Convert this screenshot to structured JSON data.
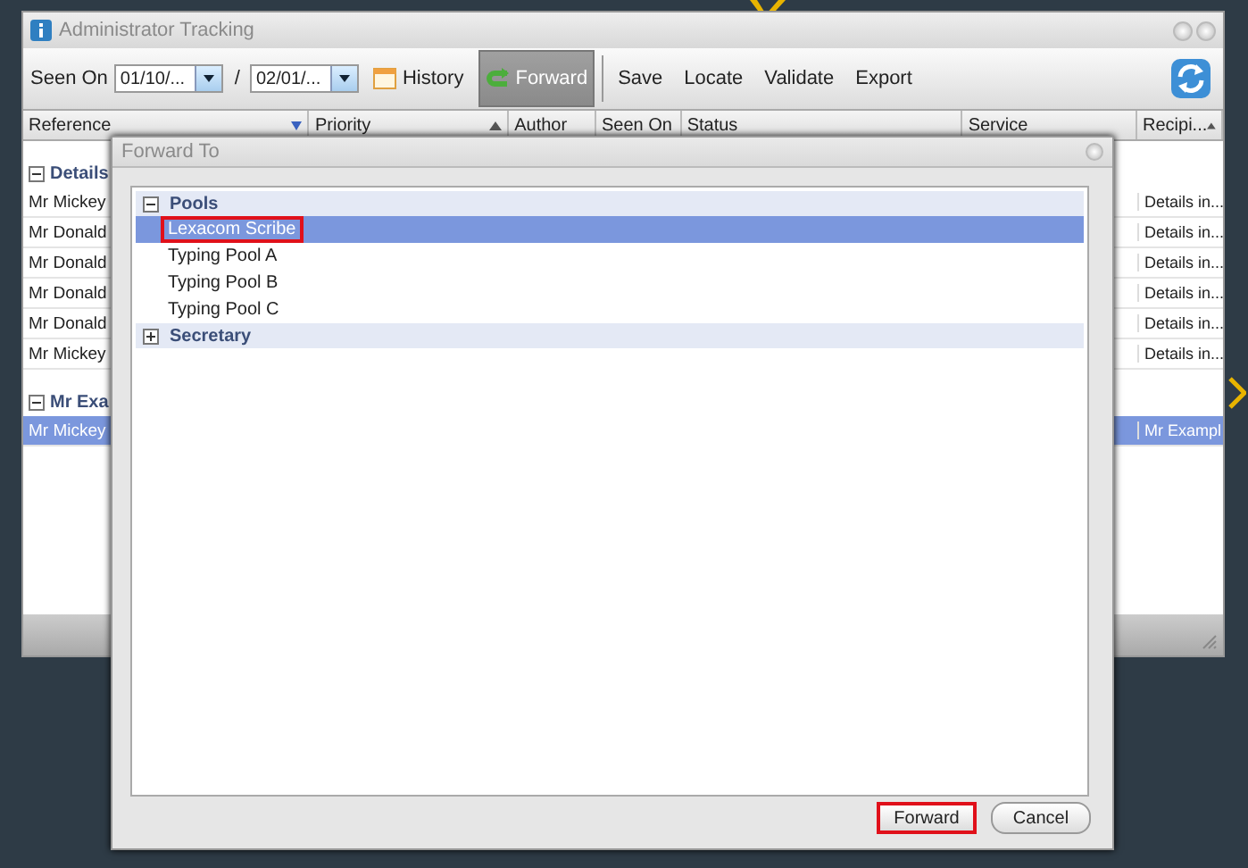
{
  "window": {
    "title": "Administrator Tracking"
  },
  "toolbar": {
    "seen_on_label": "Seen On",
    "date_from": "01/10/...",
    "separator": "/",
    "date_to": "02/01/...",
    "buttons": [
      {
        "label": "History",
        "kind": "calendar",
        "selected": false
      },
      {
        "label": "Forward",
        "kind": "forward",
        "selected": true
      },
      {
        "label": "Save",
        "kind": "plain",
        "selected": false
      },
      {
        "label": "Locate",
        "kind": "plain",
        "selected": false
      },
      {
        "label": "Validate",
        "kind": "plain",
        "selected": false
      },
      {
        "label": "Export",
        "kind": "plain",
        "selected": false
      }
    ]
  },
  "table": {
    "columns": [
      {
        "label": "Reference",
        "filtered": true,
        "sorted": false
      },
      {
        "label": "Priority",
        "filtered": false,
        "sorted": true
      },
      {
        "label": "Author",
        "filtered": false,
        "sorted": false
      },
      {
        "label": "Seen On",
        "filtered": false,
        "sorted": false
      },
      {
        "label": "Status",
        "filtered": false,
        "sorted": false
      },
      {
        "label": "Service",
        "filtered": false,
        "sorted": false
      },
      {
        "label": "Recipi...",
        "filtered": false,
        "sorted": true
      }
    ],
    "groups": [
      {
        "title": "Details",
        "expanded": true,
        "rows": [
          {
            "reference": "Mr Mickey",
            "recipient": "Details in...",
            "selected": false
          },
          {
            "reference": "Mr Donald",
            "recipient": "Details in...",
            "selected": false
          },
          {
            "reference": "Mr Donald",
            "recipient": "Details in...",
            "selected": false
          },
          {
            "reference": "Mr Donald",
            "recipient": "Details in...",
            "selected": false
          },
          {
            "reference": "Mr Donald",
            "recipient": "Details in...",
            "selected": false
          },
          {
            "reference": "Mr Mickey",
            "recipient": "Details in...",
            "selected": false
          }
        ]
      },
      {
        "title": "Mr Exa",
        "expanded": true,
        "rows": [
          {
            "reference": "Mr Mickey",
            "recipient": "Mr Exampl",
            "selected": true
          }
        ]
      }
    ]
  },
  "dialog": {
    "title": "Forward To",
    "tree": [
      {
        "label": "Pools",
        "expanded": true,
        "children": [
          {
            "label": "Lexacom Scribe",
            "selected": true,
            "marked": true
          },
          {
            "label": "Typing Pool A",
            "selected": false,
            "marked": false
          },
          {
            "label": "Typing Pool B",
            "selected": false,
            "marked": false
          },
          {
            "label": "Typing Pool C",
            "selected": false,
            "marked": false
          }
        ]
      },
      {
        "label": "Secretary",
        "expanded": false
      }
    ],
    "buttons": [
      {
        "label": "Forward",
        "marked": true
      },
      {
        "label": "Cancel",
        "marked": false
      }
    ]
  }
}
